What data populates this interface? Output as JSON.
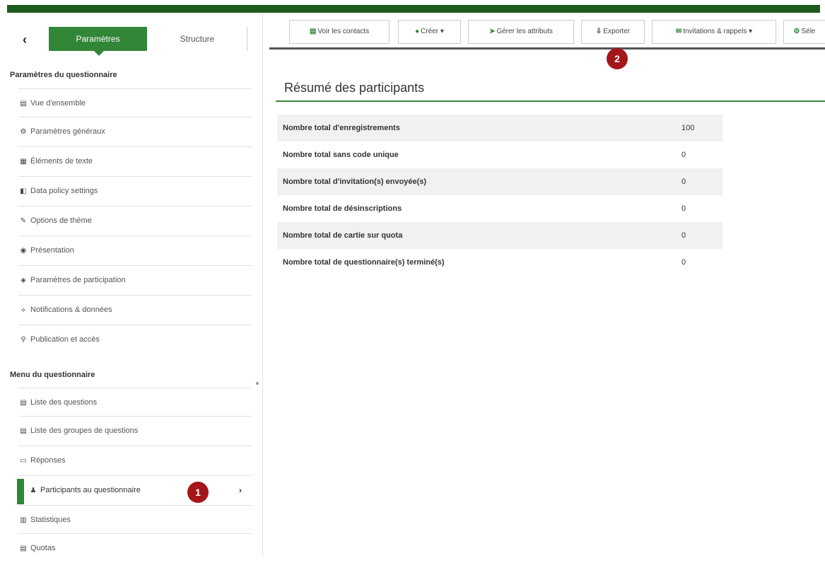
{
  "sidebar": {
    "back_icon": "‹",
    "tab_params": "Paramètres",
    "tab_structure": "Structure",
    "section1_title": "Paramètres du questionnaire",
    "items1": [
      {
        "icon": "▤",
        "label": "Vue d'ensemble"
      },
      {
        "icon": "⚙",
        "label": "Paramètres généraux"
      },
      {
        "icon": "▦",
        "label": "Éléments de texte"
      },
      {
        "icon": "◧",
        "label": "Data policy settings"
      },
      {
        "icon": "✎",
        "label": "Options de thème"
      },
      {
        "icon": "◉",
        "label": "Présentation"
      },
      {
        "icon": "◈",
        "label": "Paramètres de participation"
      },
      {
        "icon": "⟡",
        "label": "Notifications & données"
      },
      {
        "icon": "⚲",
        "label": "Publication et accès"
      }
    ],
    "section2_title": "Menu du questionnaire",
    "items2": [
      {
        "icon": "▤",
        "label": "Liste des questions"
      },
      {
        "icon": "▤",
        "label": "Liste des groupes de questions"
      },
      {
        "icon": "▭",
        "label": "Réponses"
      },
      {
        "icon": "♟",
        "label": "Participants au questionnaire",
        "active": true
      },
      {
        "icon": "▥",
        "label": "Statistiques"
      },
      {
        "icon": "▤",
        "label": "Quotas"
      }
    ],
    "badge1": "1",
    "chevron": "›"
  },
  "toolbar": {
    "buttons": [
      {
        "icon": "▤",
        "label": "Voir les contacts"
      },
      {
        "icon": "●",
        "label": "Créer  ▾"
      },
      {
        "icon": "➤",
        "label": "Gérer les attributs"
      },
      {
        "icon": "⇩",
        "label": "Exporter"
      },
      {
        "icon": "✉",
        "label": "Invitations & rappels ▾"
      },
      {
        "icon": "⚙",
        "label": "Séle"
      }
    ],
    "badge2": "2"
  },
  "main": {
    "title": "Résumé des participants",
    "rows": [
      {
        "label": "Nombre total d'enregistrements",
        "value": "100"
      },
      {
        "label": "Nombre total sans code unique",
        "value": "0"
      },
      {
        "label": "Nombre total d'invitation(s) envoyée(s)",
        "value": "0"
      },
      {
        "label": "Nombre total de désinscriptions",
        "value": "0"
      },
      {
        "label": "Nombre total de cartie sur quota",
        "value": "0"
      },
      {
        "label": "Nombre total de questionnaire(s) terminé(s)",
        "value": "0"
      }
    ]
  },
  "colors": {
    "accent": "#328637",
    "badge": "#a4161a",
    "topbar": "#1e5a1e"
  }
}
